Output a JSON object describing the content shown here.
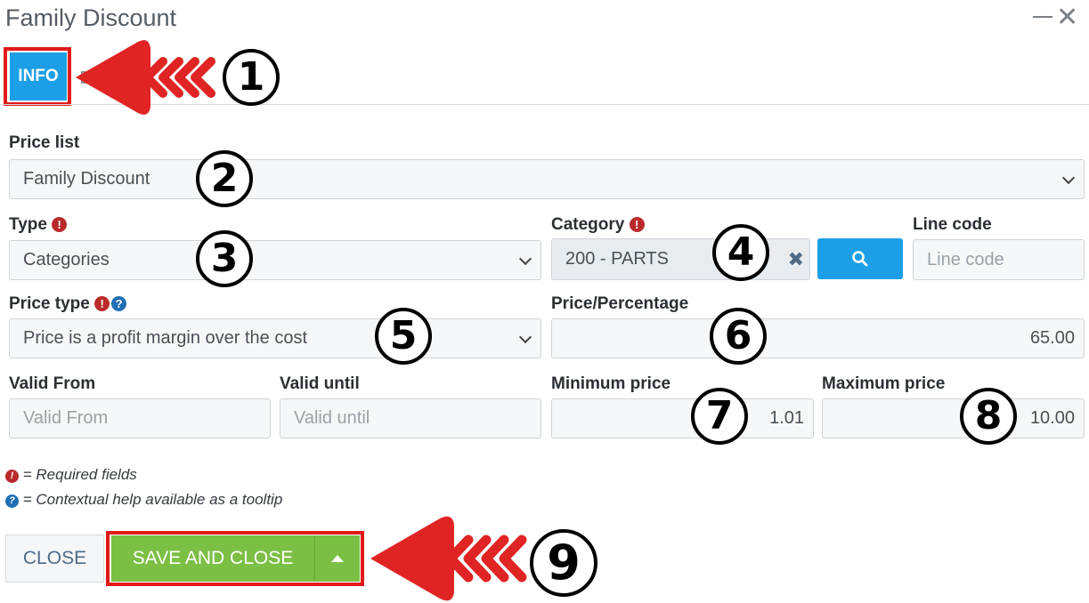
{
  "window": {
    "title": "Family Discount",
    "minimize_icon": "minimize-icon",
    "close_icon": "close-icon"
  },
  "tabs": [
    {
      "label": "INFO",
      "active": true
    }
  ],
  "form": {
    "price_list": {
      "label": "Price list",
      "value": "Family Discount"
    },
    "type": {
      "label": "Type",
      "value": "Categories",
      "required": true
    },
    "category": {
      "label": "Category",
      "value": "200 - PARTS",
      "required": true
    },
    "line_code": {
      "label": "Line code",
      "placeholder": "Line code"
    },
    "price_type": {
      "label": "Price type",
      "value": "Price is a profit margin over the cost",
      "required": true,
      "help": true
    },
    "price_percentage": {
      "label": "Price/Percentage",
      "value": "65.00"
    },
    "valid_from": {
      "label": "Valid From",
      "placeholder": "Valid From"
    },
    "valid_until": {
      "label": "Valid until",
      "placeholder": "Valid until"
    },
    "minimum_price": {
      "label": "Minimum price",
      "value": "1.01"
    },
    "maximum_price": {
      "label": "Maximum price",
      "value": "10.00"
    }
  },
  "legend": {
    "required": "= Required fields",
    "help": "= Contextual help available as a tooltip"
  },
  "footer": {
    "close_label": "CLOSE",
    "save_label": "SAVE AND CLOSE"
  },
  "annotations": [
    "1",
    "2",
    "3",
    "4",
    "5",
    "6",
    "7",
    "8",
    "9"
  ],
  "colors": {
    "accent": "#1c9fe6",
    "save": "#7cbf45",
    "highlight": "#e11b1b",
    "required": "#b92b2b",
    "help": "#1f6fb5"
  }
}
